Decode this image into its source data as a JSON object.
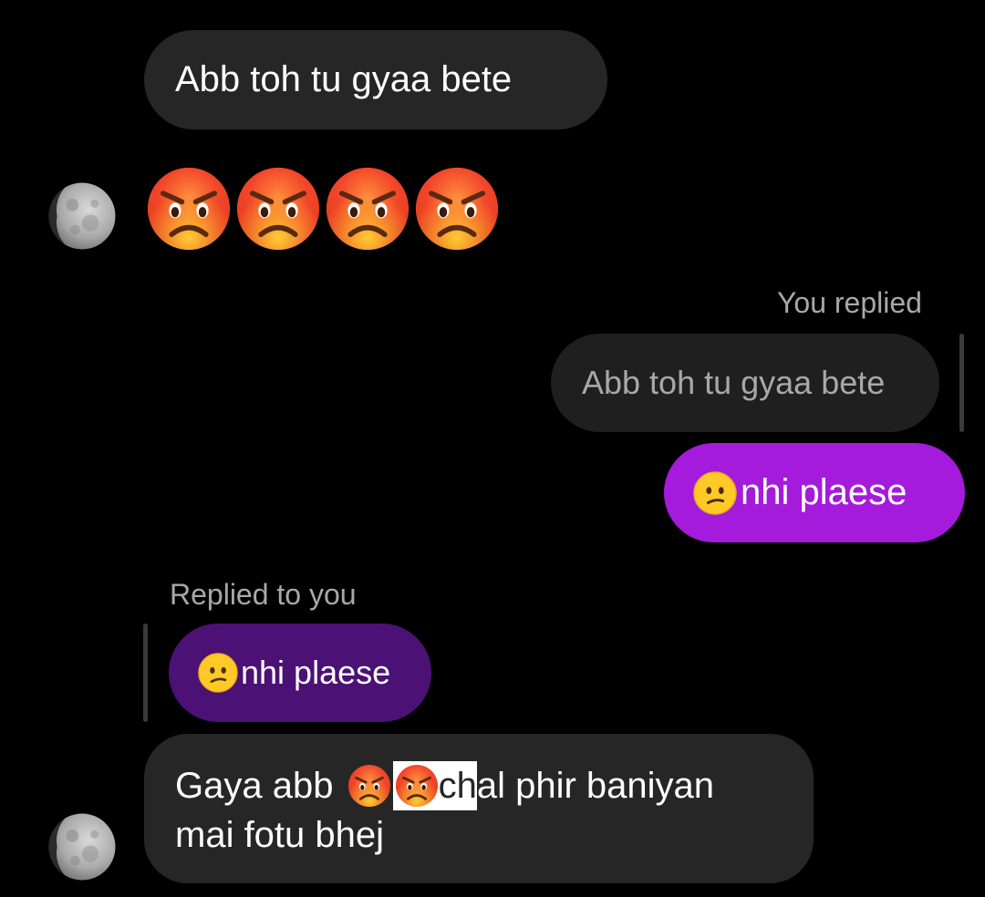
{
  "messages": {
    "m1": {
      "text": "Abb toh tu gyaa bete"
    },
    "m2": {
      "emojis": [
        "pouting-face",
        "pouting-face",
        "pouting-face",
        "pouting-face"
      ]
    },
    "m3": {
      "reply_label": "You replied",
      "quoted_text": "Abb toh tu gyaa bete",
      "text": "nhi plaese",
      "emoji": "confused-face"
    },
    "m4": {
      "reply_label": "Replied to you",
      "quoted_text": "nhi plaese",
      "quoted_emoji": "confused-face"
    },
    "m5": {
      "line1_prefix": "Gaya abb ",
      "line1_selected": "ch",
      "line1_suffix": "al phir baniyan",
      "line2": "mai fotu bhej",
      "emojis": [
        "pouting-face",
        "pouting-face"
      ]
    }
  },
  "colors": {
    "incoming_bubble": "#262626",
    "outgoing_bubble": "#a41bdc",
    "quoted_outgoing_bubble": "#4b1174",
    "quoted_incoming_bubble": "#1f1f1f"
  }
}
